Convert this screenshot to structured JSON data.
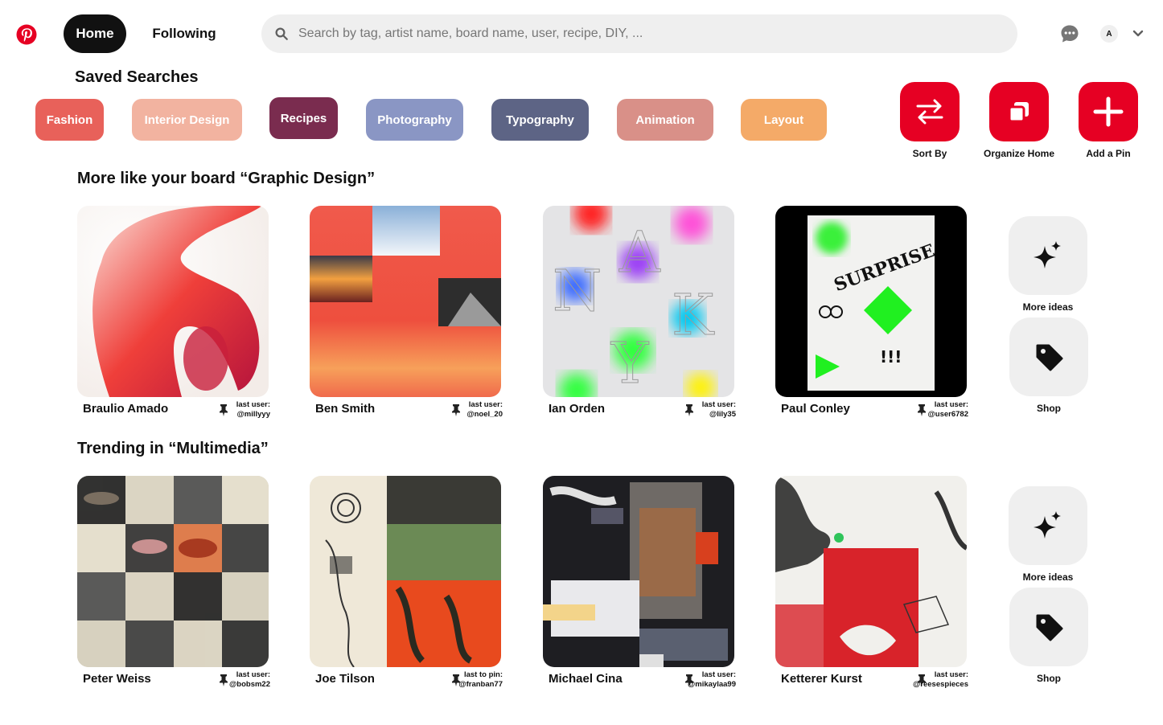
{
  "colors": {
    "brand": "#e60023",
    "home_bg": "#111111",
    "search_bg": "#efefef"
  },
  "header": {
    "home_label": "Home",
    "following_label": "Following",
    "search_placeholder": "Search by tag, artist name, board name, user, recipe, DIY, ...",
    "avatar_initial": "A",
    "icons": [
      "pinterest-logo-icon",
      "search-icon",
      "messages-icon",
      "chevron-down-icon"
    ]
  },
  "saved_searches": {
    "title": "Saved Searches",
    "chips": [
      {
        "label": "Fashion",
        "color": "#e8615a"
      },
      {
        "label": "Interior Design",
        "color": "#f2b3a0"
      },
      {
        "label": "Recipes",
        "color": "#7a2c4f"
      },
      {
        "label": "Photography",
        "color": "#8a96c4"
      },
      {
        "label": "Typography",
        "color": "#5d6485"
      },
      {
        "label": "Animation",
        "color": "#d99088"
      },
      {
        "label": "Layout",
        "color": "#f4aa68"
      }
    ]
  },
  "actions": [
    {
      "label": "Sort By",
      "icon": "swap-arrows-icon"
    },
    {
      "label": "Organize Home",
      "icon": "copy-icon"
    },
    {
      "label": "Add a Pin",
      "icon": "plus-icon"
    }
  ],
  "sections": [
    {
      "title": "More like your board “Graphic Design”",
      "cards": [
        {
          "artist": "Braulio Amado",
          "meta_label": "last user:",
          "user": "@millyyy"
        },
        {
          "artist": "Ben Smith",
          "meta_label": "last user:",
          "user": "@noel_20"
        },
        {
          "artist": "Ian Orden",
          "meta_label": "last user:",
          "user": "@lily35"
        },
        {
          "artist": "Paul Conley",
          "meta_label": "last user:",
          "user": "@user6782"
        }
      ],
      "more_ideas_label": "More ideas",
      "shop_label": "Shop"
    },
    {
      "title": "Trending in “Multimedia”",
      "cards": [
        {
          "artist": "Peter Weiss",
          "meta_label": "last user:",
          "user": "@bobsm22"
        },
        {
          "artist": "Joe Tilson",
          "meta_label": "last to pin:",
          "user": "@franban77"
        },
        {
          "artist": "Michael Cina",
          "meta_label": "last user:",
          "user": "@mikaylaa99"
        },
        {
          "artist": "Ketterer Kurst",
          "meta_label": "last user:",
          "user": "@reesespieces"
        }
      ],
      "more_ideas_label": "More ideas",
      "shop_label": "Shop"
    }
  ],
  "artwork_text": {
    "paul_conley": "SURPRISE",
    "ian_orden_letters": [
      "N",
      "A",
      "K",
      "Y"
    ],
    "exclaim": "!!!"
  }
}
